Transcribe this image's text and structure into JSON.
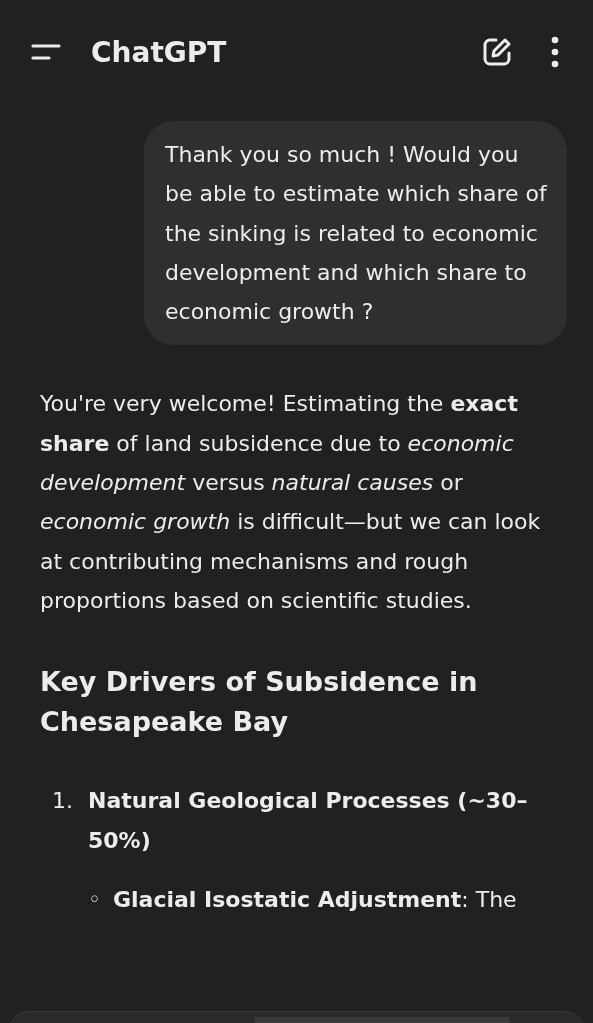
{
  "header": {
    "title": "ChatGPT"
  },
  "messages": [
    {
      "kind": "user",
      "text": "Thank you so much ! Would you be able to estimate which share of the sinking is related to economic development and which share to economic growth ?"
    },
    {
      "kind": "assistant",
      "blocks": [
        {
          "kind": "paragraph",
          "text": "You're very welcome! Estimating the **exact share** of land subsidence due to *economic development* versus *natural causes* or *economic growth* is difficult—but we can look at contributing mechanisms and rough proportions based on scientific studies."
        },
        {
          "kind": "heading",
          "text": "Key Drivers of Subsidence in Chesapeake Bay"
        },
        {
          "kind": "list",
          "items": [
            {
              "marker": "1.",
              "text": "Natural Geological Processes (~30–50%)",
              "children": [
                {
                  "marker": "◦",
                  "text": "**Glacial Isostatic Adjustment**: The"
                }
              ]
            }
          ]
        }
      ]
    }
  ]
}
